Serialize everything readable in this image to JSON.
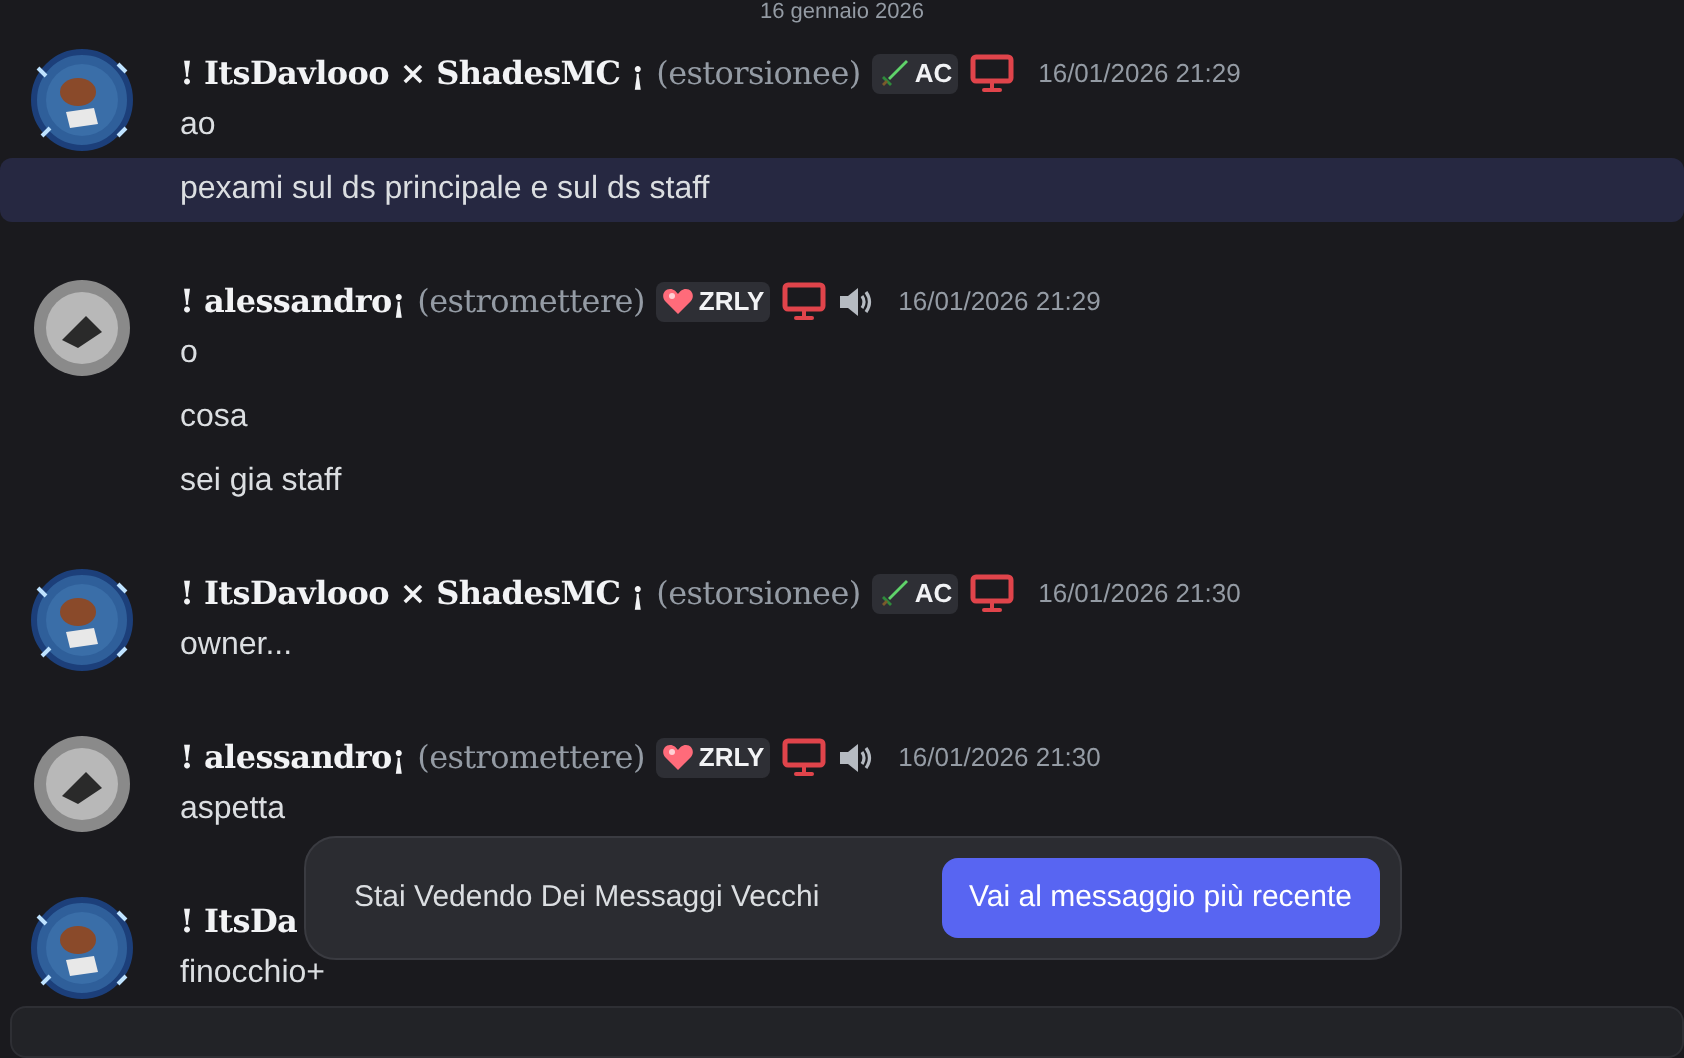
{
  "date_divider": "16 gennaio 2026",
  "messages": [
    {
      "author": "! ItsDavlooo × ShadesMC ¡",
      "username": "(estorsionee)",
      "kind": "ring",
      "tag": {
        "kind": "sword",
        "text": "AC"
      },
      "screen_icon": true,
      "speaker_icon": false,
      "timestamp": "16/01/2026 21:29",
      "lines": [
        {
          "text": "ao",
          "highlighted": false
        },
        {
          "text": "pexami sul ds principale e sul ds staff",
          "highlighted": true
        }
      ]
    },
    {
      "author": "! alessandro¡",
      "username": "(estromettere)",
      "kind": "plain",
      "tag": {
        "kind": "heart",
        "text": "ZRLY"
      },
      "screen_icon": true,
      "speaker_icon": true,
      "timestamp": "16/01/2026 21:29",
      "lines": [
        {
          "text": "o",
          "highlighted": false
        },
        {
          "text": "cosa",
          "highlighted": false
        },
        {
          "text": "sei gia staff",
          "highlighted": false
        }
      ]
    },
    {
      "author": "! ItsDavlooo × ShadesMC ¡",
      "username": "(estorsionee)",
      "kind": "ring",
      "tag": {
        "kind": "sword",
        "text": "AC"
      },
      "screen_icon": true,
      "speaker_icon": false,
      "timestamp": "16/01/2026 21:30",
      "lines": [
        {
          "text": "owner...",
          "highlighted": false
        }
      ]
    },
    {
      "author": "! alessandro¡",
      "username": "(estromettere)",
      "kind": "plain",
      "tag": {
        "kind": "heart",
        "text": "ZRLY"
      },
      "screen_icon": true,
      "speaker_icon": true,
      "timestamp": "16/01/2026 21:30",
      "lines": [
        {
          "text": "aspetta",
          "highlighted": false
        }
      ]
    },
    {
      "author": "! ItsDa",
      "kind": "ring",
      "screen_icon": false,
      "speaker_icon": false,
      "lines": [
        {
          "text": "finocchio+",
          "highlighted": false
        }
      ]
    }
  ],
  "old_messages_bar": {
    "text": "Stai Vedendo Dei Messaggi Vecchi",
    "button": "Vai al messaggio più recente"
  }
}
